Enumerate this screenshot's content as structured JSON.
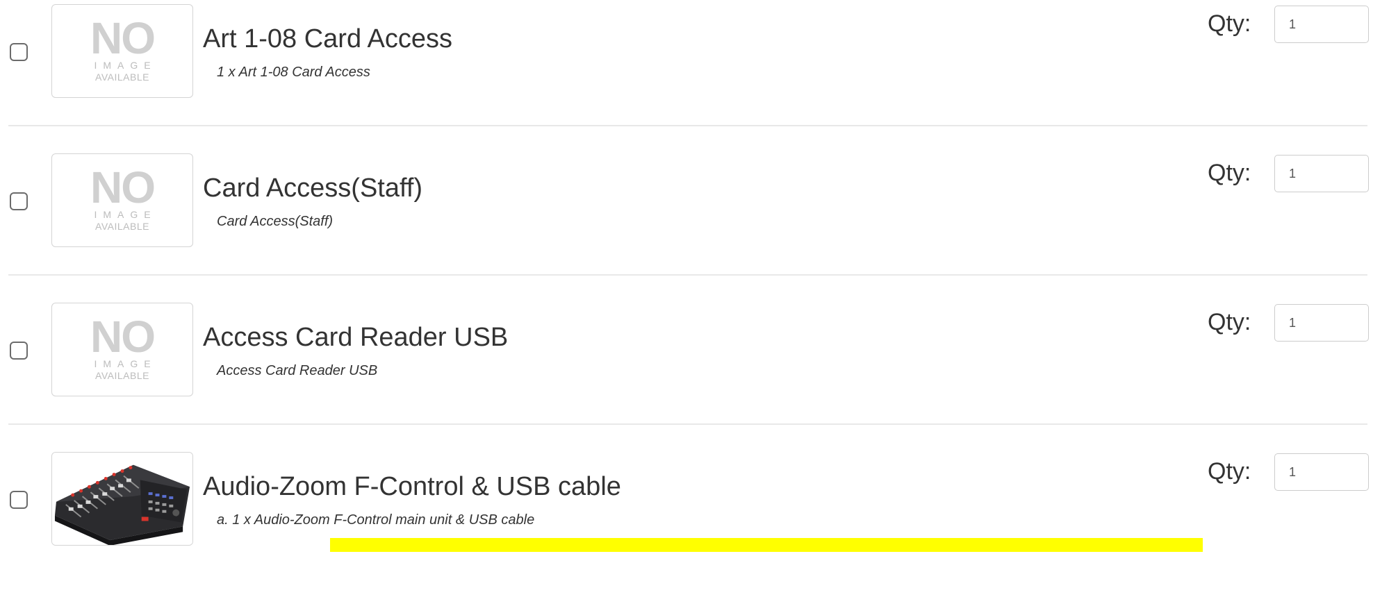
{
  "products": [
    {
      "title": "Art 1-08 Card Access",
      "description": "1 x Art 1-08 Card Access",
      "image": "no-image",
      "qty_label": "Qty:",
      "qty_value": "1",
      "checked": false
    },
    {
      "title": "Card Access(Staff)",
      "description": "Card Access(Staff)",
      "image": "no-image",
      "qty_label": "Qty:",
      "qty_value": "1",
      "checked": false
    },
    {
      "title": "Access Card Reader USB",
      "description": "Access Card Reader USB",
      "image": "no-image",
      "qty_label": "Qty:",
      "qty_value": "1",
      "checked": false
    },
    {
      "title": "Audio-Zoom F-Control & USB cable",
      "description": "a. 1 x Audio-Zoom F-Control main unit & USB cable",
      "image": "mixer-photo",
      "qty_label": "Qty:",
      "qty_value": "1",
      "checked": false
    }
  ],
  "no_image_placeholder": {
    "line1": "NO",
    "line2": "IMAGE",
    "line3": "AVAILABLE"
  },
  "colors": {
    "highlight": "#ffff00",
    "divider": "#e8e8e8",
    "text": "#333333"
  }
}
